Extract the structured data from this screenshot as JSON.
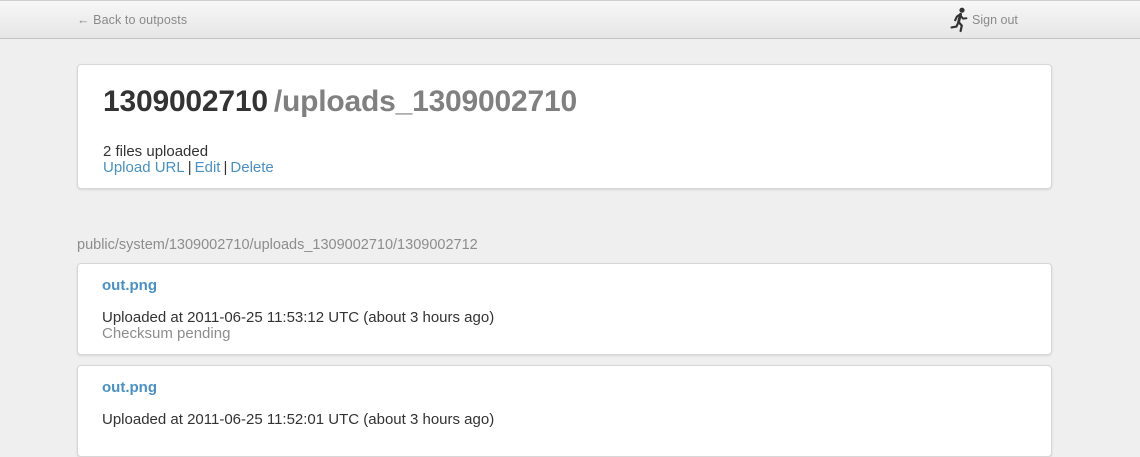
{
  "topbar": {
    "back_label": "← Back to outposts",
    "signout_label": "Sign out",
    "signout_icon": "running-man-icon"
  },
  "outpost": {
    "id": "1309002710",
    "path": "/uploads_1309002710",
    "files_count": "2 files uploaded",
    "actions": {
      "upload_url": "Upload URL",
      "separator": "|",
      "edit": "Edit",
      "delete": "Delete"
    }
  },
  "directory": {
    "path": "public/system/1309002710/uploads_1309002710/1309002712"
  },
  "files": [
    {
      "name": "out.png",
      "uploaded": "Uploaded at 2011-06-25 11:53:12 UTC (about 3 hours ago)",
      "checksum": "Checksum pending"
    },
    {
      "name": "out.png",
      "uploaded": "Uploaded at 2011-06-25 11:52:01 UTC (about 3 hours ago)",
      "checksum": ""
    }
  ],
  "colors": {
    "link": "#4a91c2",
    "text": "#333333",
    "muted": "#8d8d8d",
    "background": "#efefef"
  }
}
